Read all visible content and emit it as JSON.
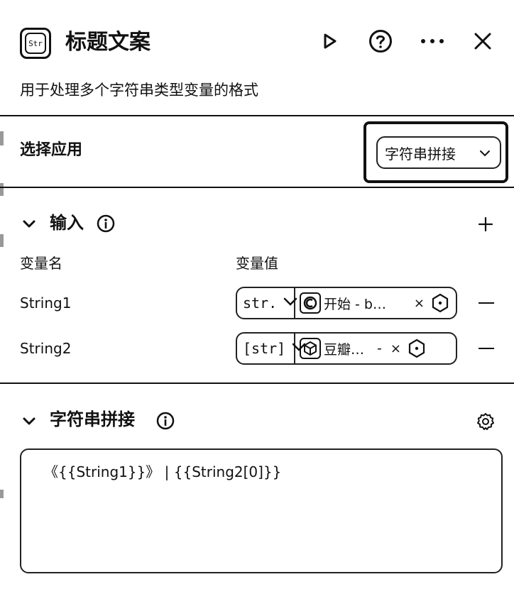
{
  "header": {
    "logo_text": "Str",
    "title": "标题文案",
    "description": "用于处理多个字符串类型变量的格式",
    "icons": [
      "play-icon",
      "help-icon",
      "more-icon",
      "close-icon"
    ]
  },
  "app_select": {
    "label": "选择应用",
    "value": "字符串拼接"
  },
  "input_section": {
    "title": "输入",
    "col_name": "变量名",
    "col_value": "变量值",
    "rows": [
      {
        "name": "String1",
        "type": "str.",
        "ref_label": "开始 - b…",
        "ref_icon": "start-node-icon",
        "remove": "×"
      },
      {
        "name": "String2",
        "type": "[str]",
        "ref_label": "豆瓣…",
        "ref_suffix": "-",
        "ref_icon": "cube-node-icon",
        "remove": "×"
      }
    ]
  },
  "concat_section": {
    "title": "字符串拼接",
    "template": "《{{String1}}》 | {{String2[0]}}"
  }
}
